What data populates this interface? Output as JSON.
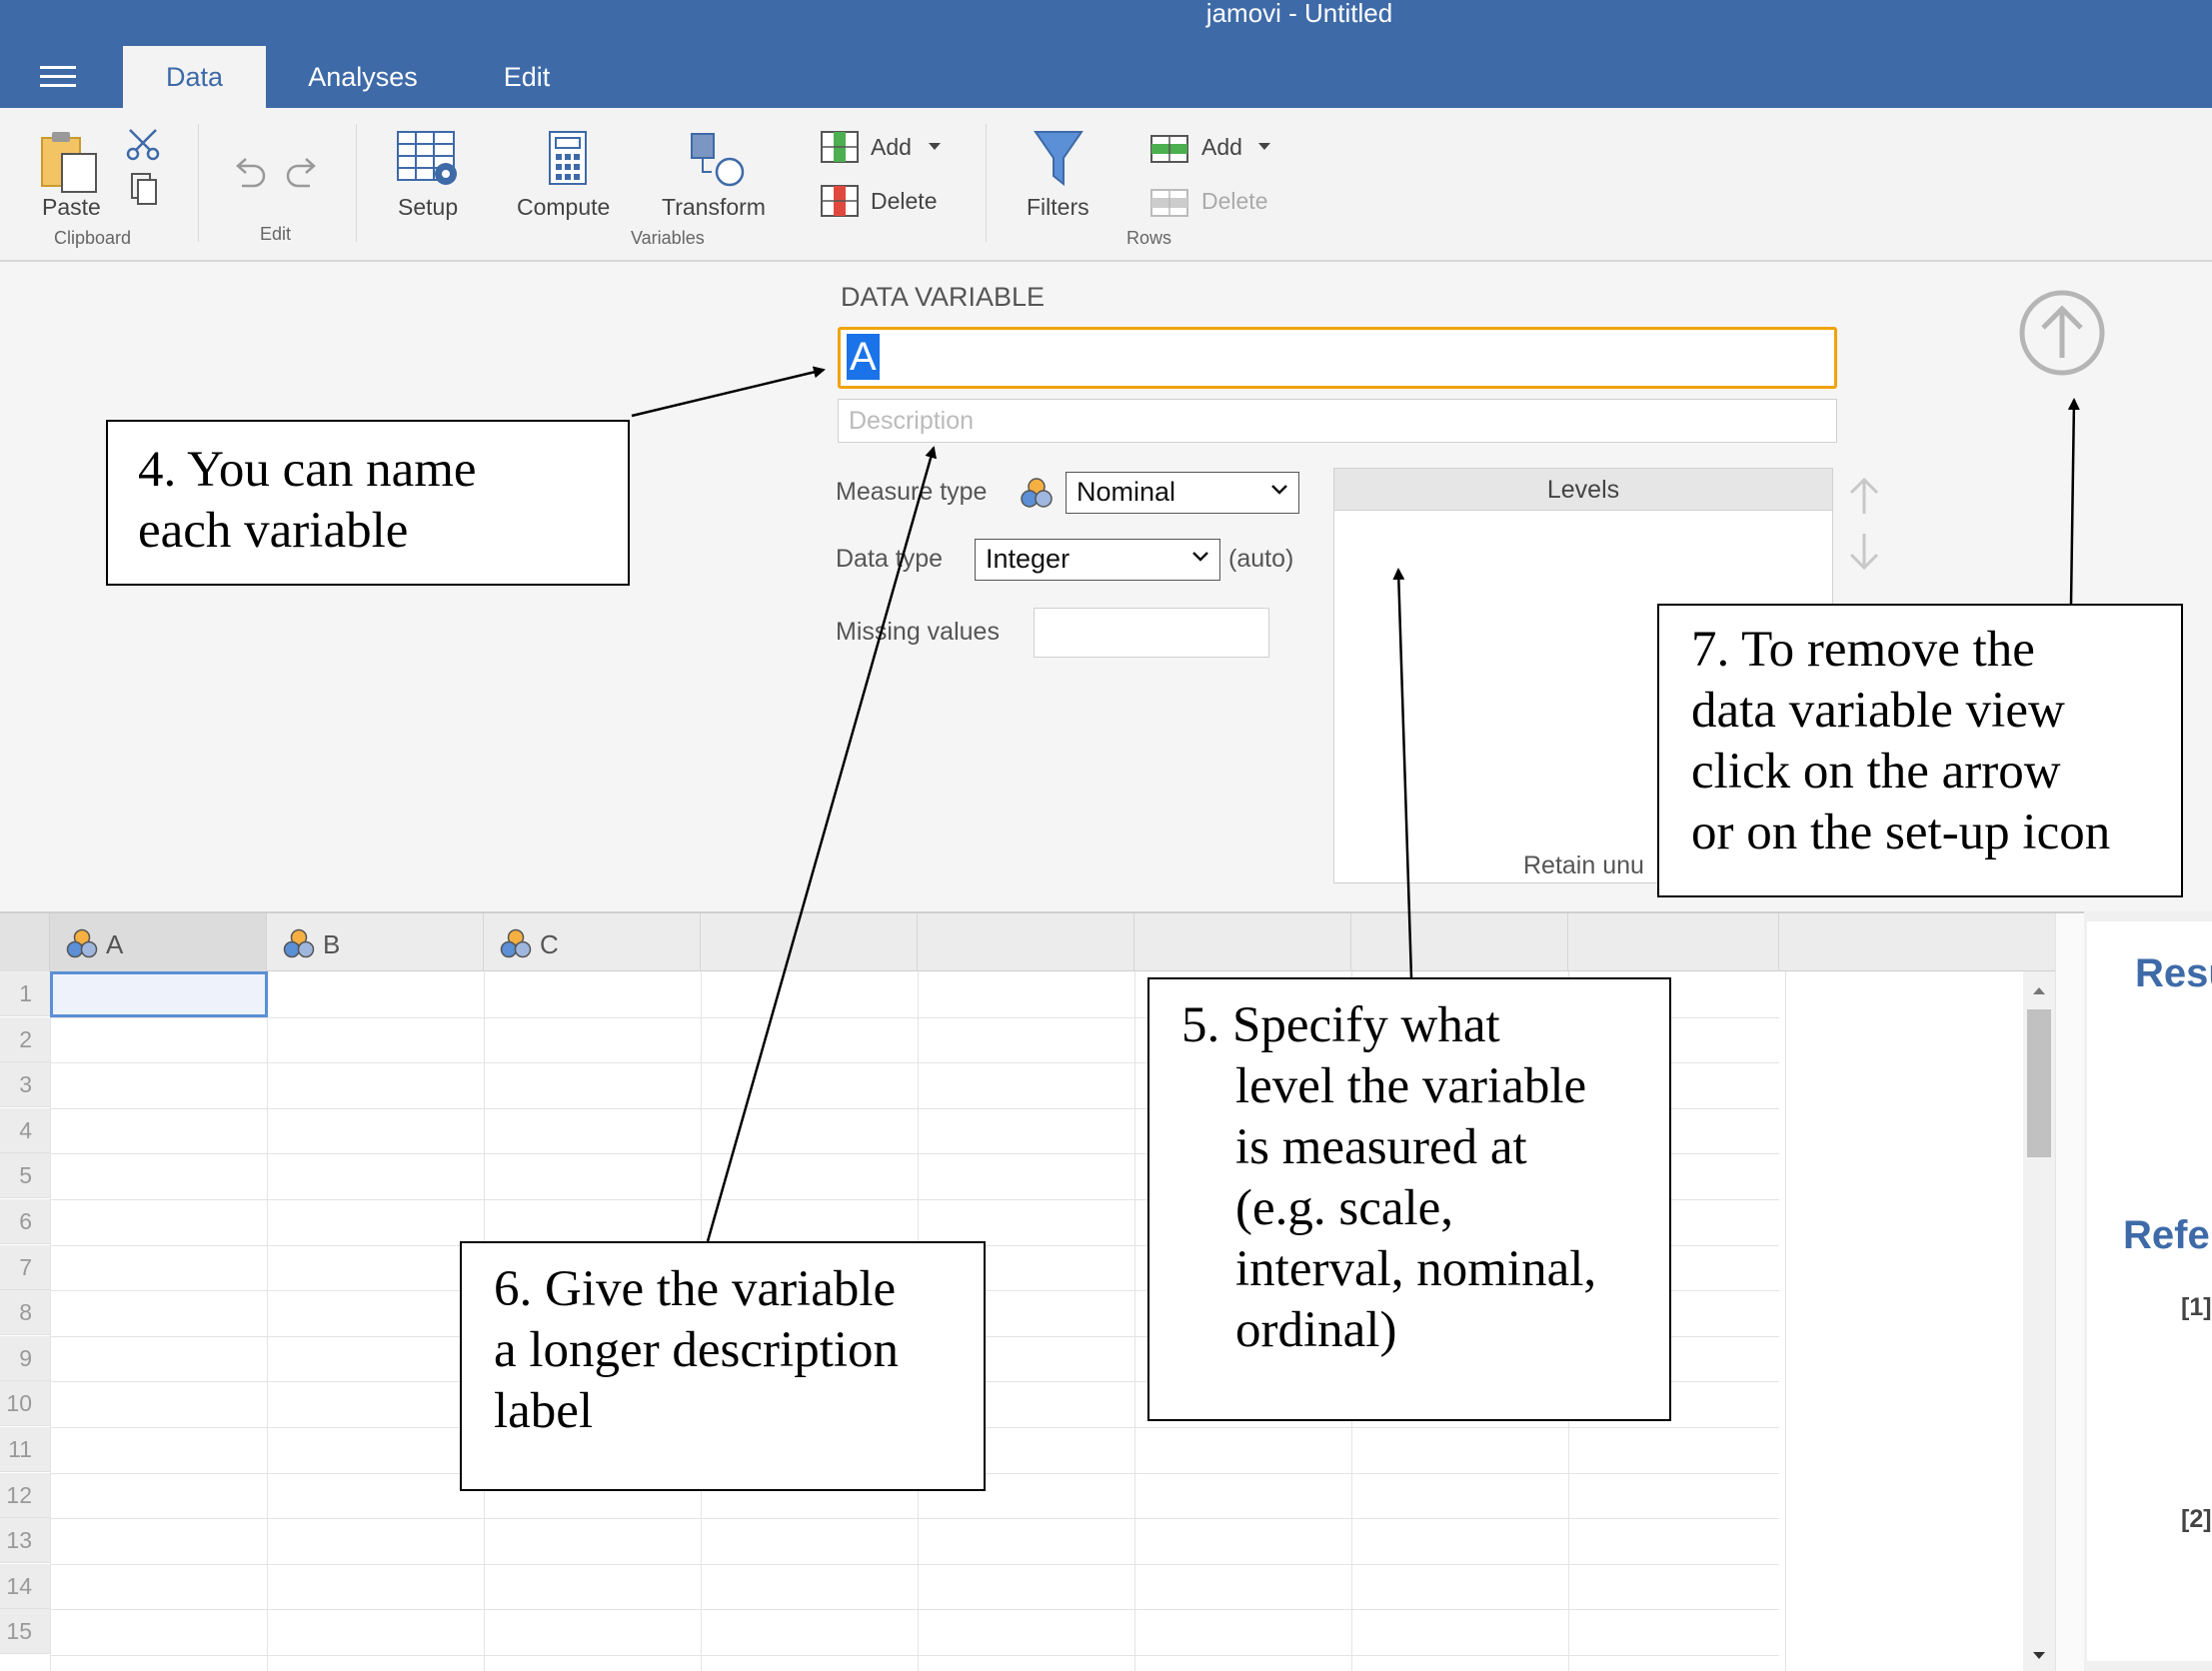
{
  "window": {
    "title": "jamovi - Untitled"
  },
  "tabs": [
    {
      "label": "Data",
      "active": true
    },
    {
      "label": "Analyses",
      "active": false
    },
    {
      "label": "Edit",
      "active": false
    }
  ],
  "ribbon": {
    "paste": "Paste",
    "clipboard_group": "Clipboard",
    "edit_group": "Edit",
    "setup": "Setup",
    "compute": "Compute",
    "transform": "Transform",
    "variables_group": "Variables",
    "var_add": "Add",
    "var_delete": "Delete",
    "filters": "Filters",
    "row_add": "Add",
    "row_delete": "Delete",
    "rows_group": "Rows"
  },
  "editor": {
    "heading": "DATA VARIABLE",
    "name_value": "A",
    "description_placeholder": "Description",
    "measure_type_label": "Measure type",
    "measure_type_value": "Nominal",
    "data_type_label": "Data type",
    "data_type_value": "Integer",
    "data_type_note": "(auto)",
    "missing_values_label": "Missing values",
    "levels_header": "Levels",
    "retain_text": "Retain unu"
  },
  "sheet": {
    "columns": [
      "A",
      "B",
      "C"
    ],
    "rows": [
      "1",
      "2",
      "3",
      "4",
      "5",
      "6",
      "7",
      "8",
      "9",
      "10",
      "11",
      "12",
      "13",
      "14",
      "15"
    ]
  },
  "results": {
    "heading1": "Resu",
    "heading2": "Refe",
    "ref1": "[1]",
    "ref2": "[2]"
  },
  "annotations": {
    "a4": [
      "4. You can name",
      "each variable"
    ],
    "a5": [
      "5. Specify what",
      "level the variable",
      "is measured at",
      "(e.g. scale,",
      "interval, nominal,",
      "ordinal)"
    ],
    "a6": [
      "6. Give the variable",
      "a longer description",
      "label"
    ],
    "a7": [
      "7. To remove the",
      "data variable view",
      "click on the arrow",
      "or on the set-up icon"
    ]
  },
  "colors": {
    "accent": "#3e6aa8",
    "focus_border": "#f0a30a",
    "selection": "#1a73e8",
    "ribbon_bg": "#f3f3f3"
  },
  "icons": [
    "hamburger-icon",
    "paste-icon",
    "scissors-icon",
    "copy-icon",
    "undo-icon",
    "redo-icon",
    "setup-icon",
    "compute-icon",
    "transform-icon",
    "add-column-icon",
    "delete-column-icon",
    "filter-icon",
    "add-row-icon",
    "delete-row-icon",
    "collapse-arrow-icon",
    "nominal-icon",
    "move-up-icon",
    "move-down-icon",
    "chevron-down-icon",
    "scroll-up-icon",
    "scroll-down-icon"
  ]
}
